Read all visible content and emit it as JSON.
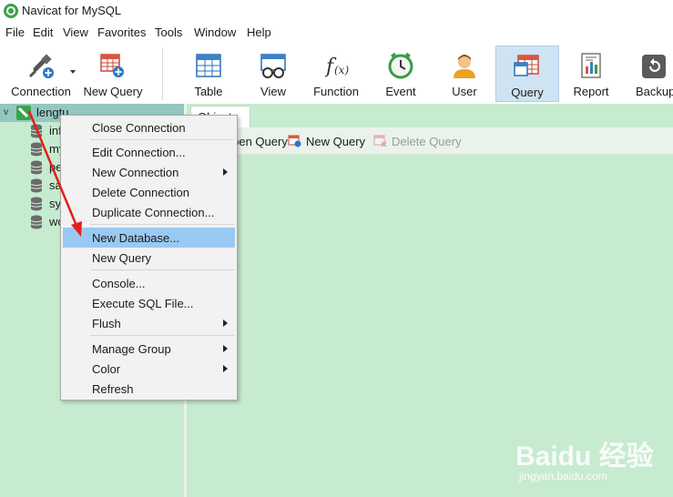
{
  "window": {
    "title": "Navicat for MySQL"
  },
  "menubar": {
    "items": [
      {
        "label": "File"
      },
      {
        "label": "Edit"
      },
      {
        "label": "View"
      },
      {
        "label": "Favorites"
      },
      {
        "label": "Tools"
      },
      {
        "label": "Window"
      },
      {
        "label": "Help"
      }
    ]
  },
  "toolbar": {
    "buttons": [
      {
        "label": "Connection",
        "icon": "plug-icon"
      },
      {
        "label": "New Query",
        "icon": "new-query-icon"
      },
      {
        "label": "Table",
        "icon": "table-icon"
      },
      {
        "label": "View",
        "icon": "view-icon"
      },
      {
        "label": "Function",
        "icon": "function-icon"
      },
      {
        "label": "Event",
        "icon": "clock-icon"
      },
      {
        "label": "User",
        "icon": "user-icon"
      },
      {
        "label": "Query",
        "icon": "query-icon",
        "active": true
      },
      {
        "label": "Report",
        "icon": "report-icon"
      },
      {
        "label": "Backup",
        "icon": "backup-icon"
      }
    ]
  },
  "tree": {
    "connection": {
      "label": "lengtu"
    },
    "databases": [
      {
        "label": "information_schema"
      },
      {
        "label": "mysql"
      },
      {
        "label": "performance_schema"
      },
      {
        "label": "sakila"
      },
      {
        "label": "sys"
      },
      {
        "label": "world"
      }
    ]
  },
  "content": {
    "tab": {
      "label": "Objects"
    },
    "object_toolbar": {
      "open_query": "Open Query",
      "new_query": "New Query",
      "delete_query": "Delete Query"
    }
  },
  "context_menu": {
    "items": [
      {
        "label": "Close Connection"
      },
      {
        "label": "Edit Connection..."
      },
      {
        "label": "New Connection",
        "submenu": true
      },
      {
        "label": "Delete Connection"
      },
      {
        "label": "Duplicate Connection..."
      },
      {
        "label": "New Database...",
        "highlighted": true
      },
      {
        "label": "New Query"
      },
      {
        "label": "Console..."
      },
      {
        "label": "Execute SQL File..."
      },
      {
        "label": "Flush",
        "submenu": true
      },
      {
        "label": "Manage Group",
        "submenu": true
      },
      {
        "label": "Color",
        "submenu": true
      },
      {
        "label": "Refresh"
      }
    ]
  },
  "watermark": {
    "logo": "Baidu 经验",
    "url": "jingyan.baidu.com"
  },
  "colors": {
    "pane_bg": "#c7ebcf",
    "selected_row": "#93c8c0",
    "menu_highlight": "#99c9f2",
    "toolbar_active": "#cfe3f3",
    "annotation": "#e0201b"
  }
}
